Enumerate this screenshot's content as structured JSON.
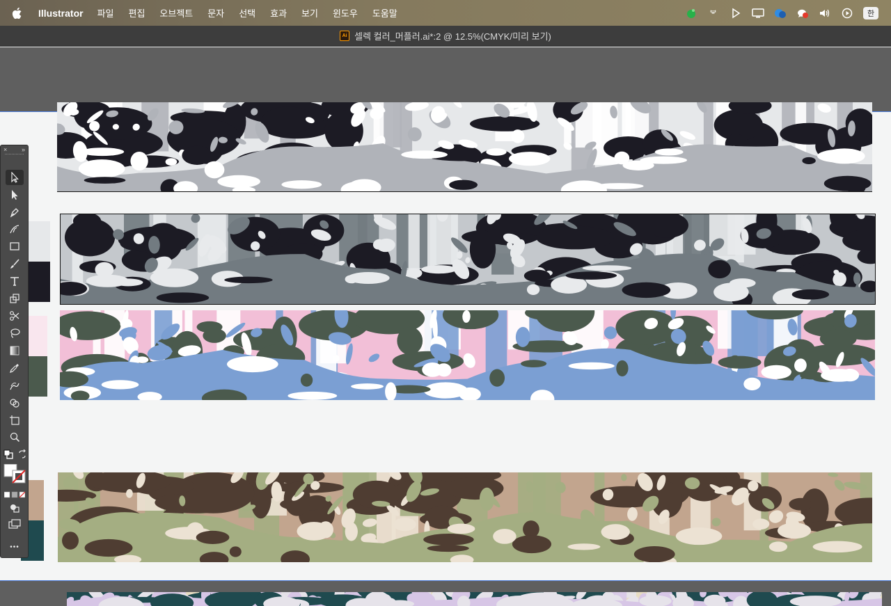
{
  "menubar": {
    "apple_icon": "apple-logo",
    "app_name": "Illustrator",
    "items": [
      "파일",
      "편집",
      "오브젝트",
      "문자",
      "선택",
      "효과",
      "보기",
      "윈도우",
      "도움말"
    ],
    "status_icons": [
      "green-app-icon",
      "kakaotalk-icon",
      "play-triangle-icon",
      "display-icon",
      "bluetooth-app-icon",
      "notification-app-icon",
      "volume-icon",
      "play-circle-icon"
    ],
    "input_source": "한"
  },
  "titlebar": {
    "doc_icon_label": "Ai",
    "title": "셀렉 컬러_머플러.ai*:2 @ 12.5%(CMYK/미리 보기)"
  },
  "tools_panel": {
    "close_label": "×",
    "collapse_label": "»",
    "tools": [
      "selection-tool",
      "direct-selection-tool",
      "pen-tool",
      "curvature-tool",
      "rectangle-tool",
      "paintbrush-tool",
      "type-tool",
      "scale-tool",
      "scissors-tool",
      "lasso-tool",
      "gradient-tool",
      "eyedropper-tool",
      "blend-tool",
      "shape-builder-tool",
      "artboard-tool",
      "zoom-tool"
    ],
    "more_label": "•••"
  },
  "artwork": {
    "strips": [
      {
        "name": "strip-1",
        "colors": [
          "#1c1b24",
          "#b0b3b9",
          "#e6e8ea",
          "#ffffff"
        ]
      },
      {
        "name": "strip-2",
        "colors": [
          "#1c1b24",
          "#727b81",
          "#c4c8cc",
          "#e8eaec"
        ]
      },
      {
        "name": "strip-3",
        "colors": [
          "#4b5a4d",
          "#7b9fd3",
          "#f2bfd7",
          "#ffffff"
        ]
      },
      {
        "name": "strip-4",
        "colors": [
          "#4f3d32",
          "#a4ae82",
          "#c2a58e",
          "#ece2d3"
        ]
      },
      {
        "name": "strip-5",
        "colors": [
          "#1f4a4f",
          "#d7c6e6",
          "#e7dcc2",
          "#e6e3ea"
        ]
      }
    ],
    "swatches": [
      "#e6e8ea",
      "#1c1b24",
      "#f9e6ee",
      "#4b5a4d",
      "#c2a58e",
      "#1f4a4f"
    ]
  }
}
